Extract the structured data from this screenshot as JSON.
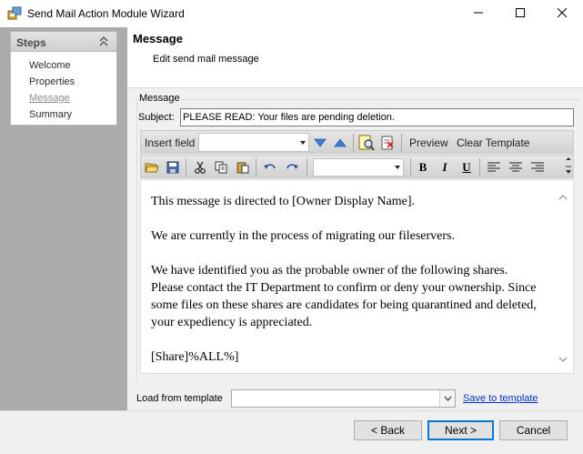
{
  "window": {
    "title": "Send Mail Action Module Wizard"
  },
  "steps": {
    "header": "Steps",
    "items": [
      {
        "label": "Welcome",
        "current": false
      },
      {
        "label": "Properties",
        "current": false
      },
      {
        "label": "Message",
        "current": true
      },
      {
        "label": "Summary",
        "current": false
      }
    ]
  },
  "page": {
    "title": "Message",
    "subtitle": "Edit send mail message"
  },
  "form": {
    "group_label": "Message",
    "subject_label": "Subject:",
    "subject_value": "PLEASE READ: Your files are pending deletion."
  },
  "toolbar1": {
    "insert_field_label": "Insert field",
    "insert_field_value": "",
    "preview_label": "Preview",
    "clear_template_label": "Clear Template"
  },
  "toolbar2": {
    "font_value": "",
    "bold_label": "B",
    "italic_label": "I",
    "underline_label": "U"
  },
  "editor": {
    "paragraphs": [
      "This message is directed to [Owner Display Name].",
      "We are currently in the process of migrating our fileservers.",
      "We have identified you as the probable owner of the following shares. Please contact the IT Department to confirm or deny your ownership. Since some files on these shares are candidates for being quarantined and deleted, your expediency is appreciated.",
      "[Share]%ALL%]"
    ]
  },
  "template": {
    "load_label": "Load from template",
    "selected_value": "",
    "save_link": "Save to template"
  },
  "buttons": {
    "back": "< Back",
    "next": "Next >",
    "cancel": "Cancel"
  },
  "colors": {
    "left_pane": "#ababab",
    "content_bg": "#f0f0f0",
    "link": "#0033cc",
    "focus_border": "#0078d7"
  }
}
